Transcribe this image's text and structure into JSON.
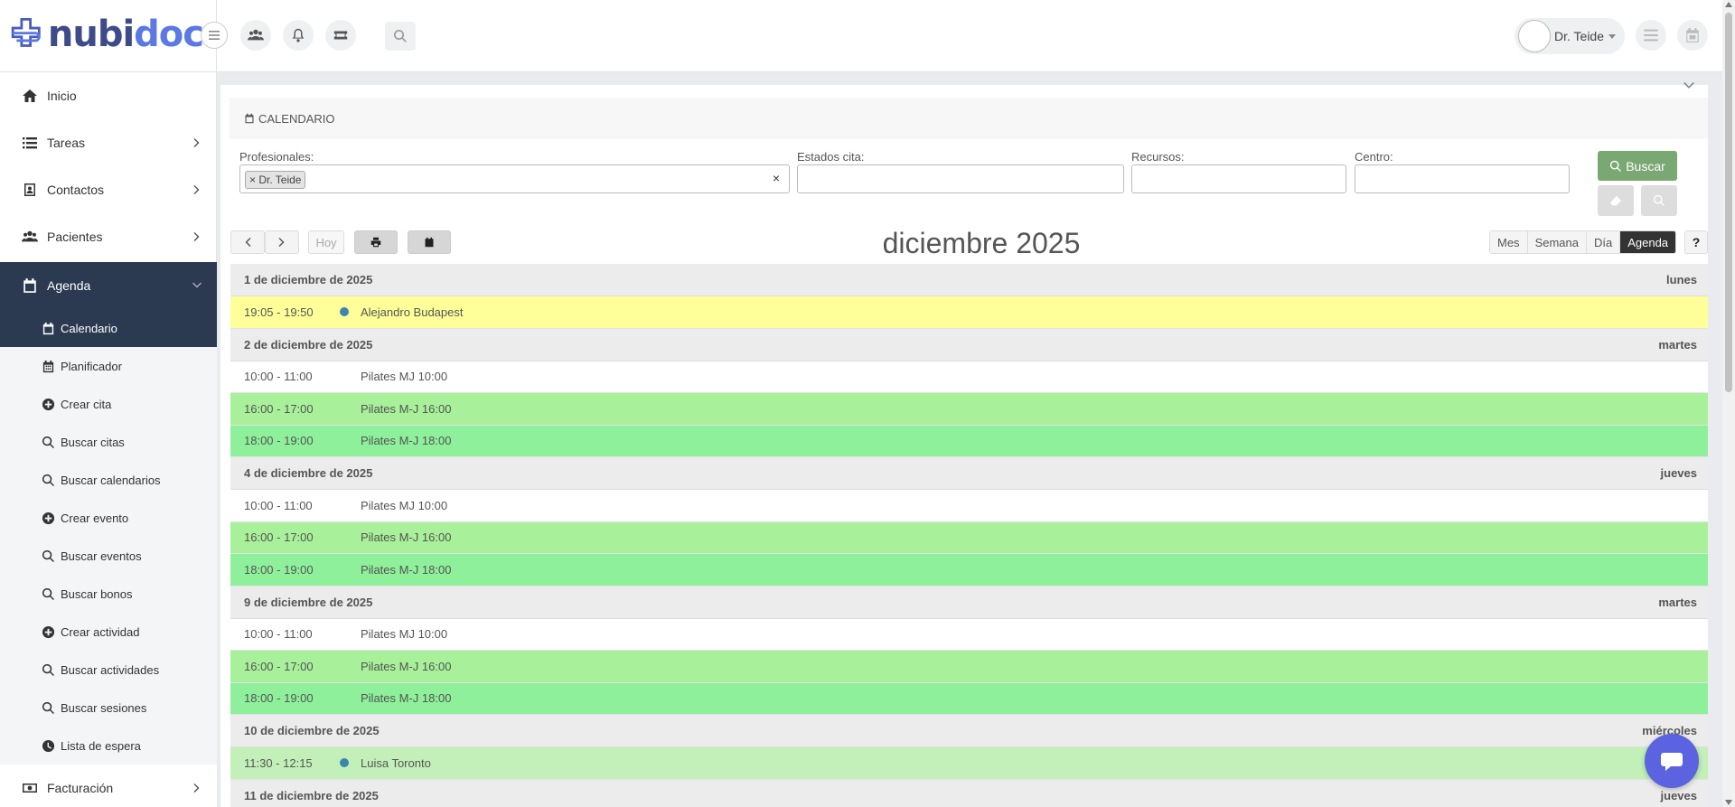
{
  "brand": {
    "name_primary": "nubi",
    "name_accent": "doc"
  },
  "header": {
    "user_name": "Dr. Teide"
  },
  "sidebar": {
    "items": [
      {
        "label": "Inicio",
        "icon": "home-icon"
      },
      {
        "label": "Tareas",
        "icon": "list-icon"
      },
      {
        "label": "Contactos",
        "icon": "contacts-icon"
      },
      {
        "label": "Pacientes",
        "icon": "users-icon"
      },
      {
        "label": "Agenda",
        "icon": "calendar-icon"
      }
    ],
    "sub_items": [
      {
        "label": "Calendario",
        "icon": "calendar-icon"
      },
      {
        "label": "Planificador",
        "icon": "grid-calendar-icon"
      },
      {
        "label": "Crear cita",
        "icon": "plus-circle-icon"
      },
      {
        "label": "Buscar citas",
        "icon": "search-icon"
      },
      {
        "label": "Buscar calendarios",
        "icon": "search-icon"
      },
      {
        "label": "Crear evento",
        "icon": "plus-circle-icon"
      },
      {
        "label": "Buscar eventos",
        "icon": "search-icon"
      },
      {
        "label": "Buscar bonos",
        "icon": "search-icon"
      },
      {
        "label": "Crear actividad",
        "icon": "plus-circle-icon"
      },
      {
        "label": "Buscar actividades",
        "icon": "search-icon"
      },
      {
        "label": "Buscar sesiones",
        "icon": "search-icon"
      },
      {
        "label": "Lista de espera",
        "icon": "clock-icon"
      }
    ],
    "footer_item": {
      "label": "Facturación",
      "icon": "money-icon"
    }
  },
  "card": {
    "title": "CALENDARIO"
  },
  "filters": {
    "profesionales_label": "Profesionales:",
    "profesionales_tag": "Dr. Teide",
    "estados_label": "Estados cita:",
    "recursos_label": "Recursos:",
    "centro_label": "Centro:",
    "buscar_label": "Buscar"
  },
  "toolbar": {
    "today_label": "Hoy",
    "month_title": "diciembre 2025",
    "views": [
      "Mes",
      "Semana",
      "Día",
      "Agenda"
    ],
    "active_view": "Agenda",
    "help_label": "?"
  },
  "agenda": [
    {
      "date": "1 de diciembre de 2025",
      "dow": "lunes",
      "events": [
        {
          "time": "19:05 - 19:50",
          "title": "Alejandro Budapest",
          "color": "#ffff99",
          "dot": true
        }
      ]
    },
    {
      "date": "2 de diciembre de 2025",
      "dow": "martes",
      "events": [
        {
          "time": "10:00 - 11:00",
          "title": "Pilates MJ 10:00",
          "color": "#ffffff",
          "dot": false
        },
        {
          "time": "16:00 - 17:00",
          "title": "Pilates M-J 16:00",
          "color": "#a8f09a",
          "dot": false
        },
        {
          "time": "18:00 - 19:00",
          "title": "Pilates M-J 18:00",
          "color": "#8ef09a",
          "dot": false
        }
      ]
    },
    {
      "date": "4 de diciembre de 2025",
      "dow": "jueves",
      "events": [
        {
          "time": "10:00 - 11:00",
          "title": "Pilates MJ 10:00",
          "color": "#ffffff",
          "dot": false
        },
        {
          "time": "16:00 - 17:00",
          "title": "Pilates M-J 16:00",
          "color": "#a8f09a",
          "dot": false
        },
        {
          "time": "18:00 - 19:00",
          "title": "Pilates M-J 18:00",
          "color": "#8ef09a",
          "dot": false
        }
      ]
    },
    {
      "date": "9 de diciembre de 2025",
      "dow": "martes",
      "events": [
        {
          "time": "10:00 - 11:00",
          "title": "Pilates MJ 10:00",
          "color": "#ffffff",
          "dot": false
        },
        {
          "time": "16:00 - 17:00",
          "title": "Pilates M-J 16:00",
          "color": "#a8f09a",
          "dot": false
        },
        {
          "time": "18:00 - 19:00",
          "title": "Pilates M-J 18:00",
          "color": "#8ef09a",
          "dot": false
        }
      ]
    },
    {
      "date": "10 de diciembre de 2025",
      "dow": "miércoles",
      "events": [
        {
          "time": "11:30 - 12:15",
          "title": "Luisa Toronto",
          "color": "#c2f0b8",
          "dot": true
        }
      ]
    },
    {
      "date": "11 de diciembre de 2025",
      "dow": "jueves",
      "events": []
    }
  ],
  "colors": {
    "sidebar_active": "#2b3a51",
    "buscar_button": "#7aa872",
    "chat_button": "#5b63e0",
    "event_dot": "#3a87ad"
  }
}
